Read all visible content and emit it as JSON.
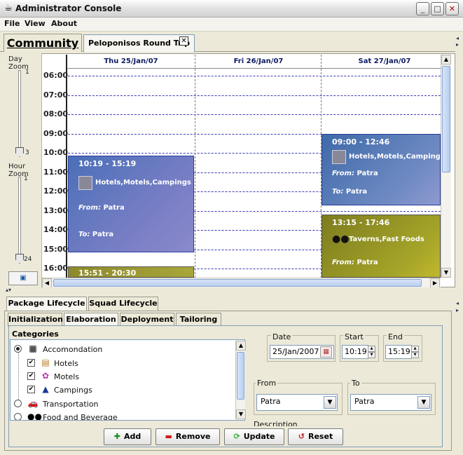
{
  "window": {
    "title": "Administrator Console",
    "minimize": "_",
    "maximize": "□",
    "close": "✕"
  },
  "menu": [
    "File",
    "View",
    "About"
  ],
  "tabs": {
    "community": "Community",
    "trip": "Peloponisos Round Trip",
    "close": "✕"
  },
  "zoom": {
    "day_label": "Day Zoom",
    "day_max": "1",
    "day_min": "3",
    "hour_label": "Hour Zoom",
    "hour_max": "1",
    "hour_min": "24",
    "day_level": 0.0,
    "hour_level": 0.0
  },
  "calendar": {
    "days": [
      "Thu 25/Jan/07",
      "Fri 26/Jan/07",
      "Sat 27/Jan/07"
    ],
    "hours": [
      "06:00",
      "07:00",
      "08:00",
      "09:00",
      "10:00",
      "11:00",
      "12:00",
      "13:00",
      "14:00",
      "15:00",
      "16:00"
    ],
    "events": [
      {
        "day": "Thu 25/Jan/07",
        "time": "10:19 - 15:19",
        "categories": "Hotels,Motels,Campings",
        "from_label": "From:",
        "from": "Patra",
        "to_label": "To:",
        "to": "Patra",
        "color": "#4a6fb8"
      },
      {
        "day": "Thu 25/Jan/07",
        "time": "15:51 - 20:30",
        "color": "#8c8a2c"
      },
      {
        "day": "Sat 27/Jan/07",
        "time": "09:00 - 12:46",
        "categories": "Hotels,Motels,Campings",
        "from_label": "From:",
        "from": "Patra",
        "to_label": "To:",
        "to": "Patra",
        "color": "#3e6aa8"
      },
      {
        "day": "Sat 27/Jan/07",
        "time": "13:15 - 17:46",
        "categories": "Taverns,Fast Foods",
        "from_label": "From:",
        "from": "Patra",
        "color": "#8a8a20"
      }
    ]
  },
  "lifecycle_tabs": [
    "Package Lifecycle",
    "Squad Lifecycle"
  ],
  "stage_tabs": [
    "Initialization",
    "Elaboration",
    "Deployment",
    "Tailoring"
  ],
  "categories": {
    "label": "Categories",
    "items": [
      {
        "label": "Accomondation",
        "type": "radio",
        "checked": true
      },
      {
        "label": "Hotels",
        "type": "check",
        "checked": true
      },
      {
        "label": "Motels",
        "type": "check",
        "checked": true
      },
      {
        "label": "Campings",
        "type": "check",
        "checked": true
      },
      {
        "label": "Transportation",
        "type": "radio",
        "checked": false
      },
      {
        "label": "Food and Beverage",
        "type": "radio",
        "checked": false
      }
    ]
  },
  "form": {
    "date_label": "Date",
    "date": "25/Jan/2007",
    "start_label": "Start",
    "start": "10:19",
    "end_label": "End",
    "end": "15:19",
    "from_label": "From",
    "from": "Patra",
    "to_label": "To",
    "to": "Patra",
    "description_label": "Description"
  },
  "buttons": {
    "add": "Add",
    "remove": "Remove",
    "update": "Update",
    "reset": "Reset"
  },
  "colors": {
    "accent": "#0d1a60",
    "event_blue": "#4a6fb8",
    "event_olive": "#8a8a20",
    "add_icon": "#1e8a1e",
    "remove_icon": "#d01a1a",
    "update_icon": "#35a935",
    "reset_icon": "#c02020"
  }
}
